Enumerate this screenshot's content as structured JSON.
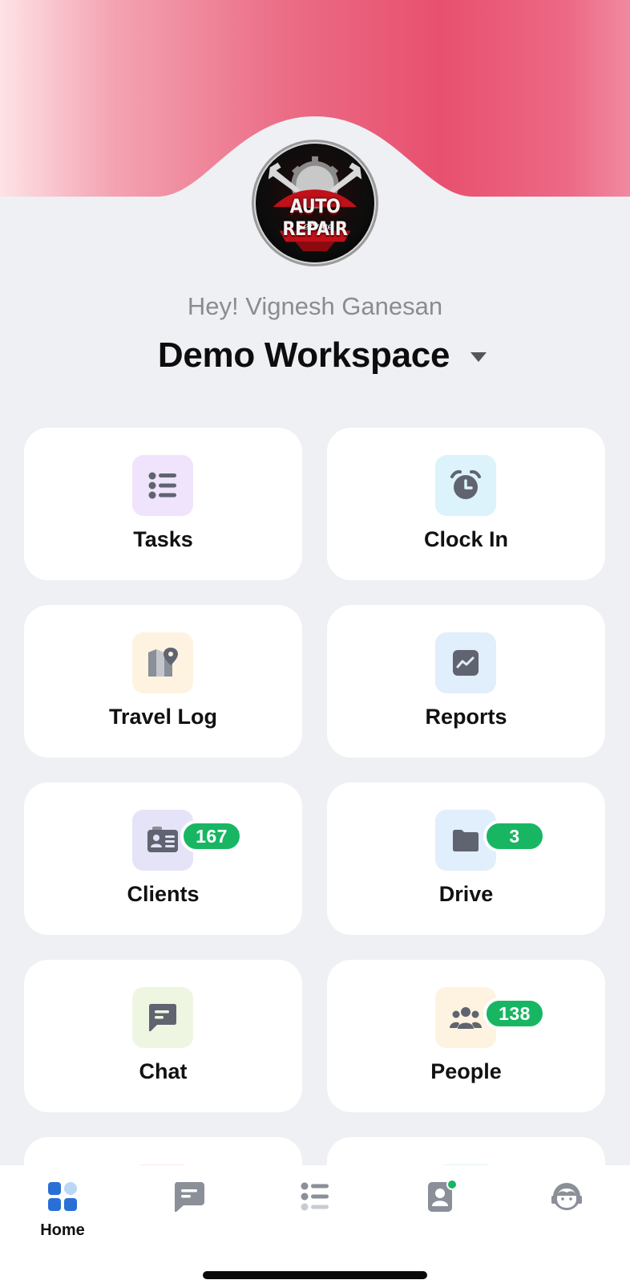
{
  "header": {
    "logo_title": "AUTO REPAIR",
    "logo_subtitle": "Service",
    "greeting": "Hey! Vignesh Ganesan",
    "workspace_name": "Demo Workspace"
  },
  "colors": {
    "header_pink": "#e8506f",
    "badge_green": "#18b663",
    "page_bg": "#eff0f4",
    "nav_active": "#2a6fd6"
  },
  "cards": [
    {
      "label": "Tasks",
      "icon": "list-icon",
      "tile_color": "#efe4fb"
    },
    {
      "label": "Clock In",
      "icon": "alarm-clock-icon",
      "tile_color": "#dcf3fb"
    },
    {
      "label": "Travel Log",
      "icon": "map-pin-icon",
      "tile_color": "#fdf3e0"
    },
    {
      "label": "Reports",
      "icon": "trend-chart-icon",
      "tile_color": "#e1eefc"
    },
    {
      "label": "Clients",
      "icon": "contact-card-icon",
      "tile_color": "#e4e3f8",
      "badge": "167"
    },
    {
      "label": "Drive",
      "icon": "folder-icon",
      "tile_color": "#e1eefc",
      "badge": "3"
    },
    {
      "label": "Chat",
      "icon": "chat-bubble-icon",
      "tile_color": "#eef6e1"
    },
    {
      "label": "People",
      "icon": "group-icon",
      "tile_color": "#fdf3e0",
      "badge": "138"
    }
  ],
  "bottom_nav": {
    "home_label": "Home",
    "items": [
      "home-grid-icon",
      "chat-icon",
      "list-icon",
      "contacts-icon",
      "support-agent-icon"
    ]
  }
}
